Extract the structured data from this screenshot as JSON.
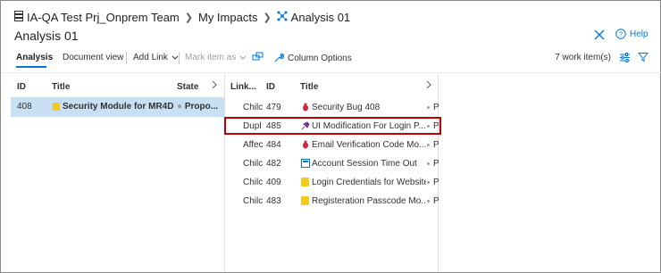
{
  "breadcrumb": {
    "project": "IA-QA Test Prj_Onprem Team",
    "section": "My Impacts",
    "current": "Analysis 01"
  },
  "page_title": "Analysis 01",
  "help_label": "Help",
  "toolbar": {
    "tab_analysis": "Analysis",
    "tab_document_view": "Document view",
    "add_link": "Add Link",
    "mark_item_as": "Mark item as",
    "column_options": "Column Options",
    "work_item_count": "7 work item(s)"
  },
  "left_table": {
    "headers": {
      "id": "ID",
      "title": "Title",
      "state": "State"
    },
    "row": {
      "id": "408",
      "title": "Security Module for MR4D...",
      "state": "Propo..."
    }
  },
  "right_table": {
    "headers": {
      "link": "Link...",
      "id": "ID",
      "title": "Title"
    },
    "rows": [
      {
        "link": "Chilc",
        "id": "479",
        "title": "Security Bug 408",
        "state": "P",
        "icon": "bug-icon"
      },
      {
        "link": "Dupl",
        "id": "485",
        "title": "UI Modification For Login P...",
        "state": "P",
        "icon": "feature-icon"
      },
      {
        "link": "Affec",
        "id": "484",
        "title": "Email Verification Code Mo...",
        "state": "P",
        "icon": "bug-icon"
      },
      {
        "link": "Chilc",
        "id": "482",
        "title": "Account Session Time Out",
        "state": "P",
        "icon": "test-case-icon"
      },
      {
        "link": "Chilc",
        "id": "409",
        "title": "Login Credentials for Website",
        "state": "P",
        "icon": "user-story-icon"
      },
      {
        "link": "Chilc",
        "id": "483",
        "title": "Registeration Passcode Mo...",
        "state": "P",
        "icon": "user-story-icon"
      }
    ]
  },
  "colors": {
    "accent": "#0078d4",
    "selected_row": "#c7e0f4",
    "highlight_border": "#c00000",
    "bug": "#cc293d",
    "feature": "#773b93",
    "user_story": "#f2cb1d",
    "test_case": "#004b50"
  }
}
